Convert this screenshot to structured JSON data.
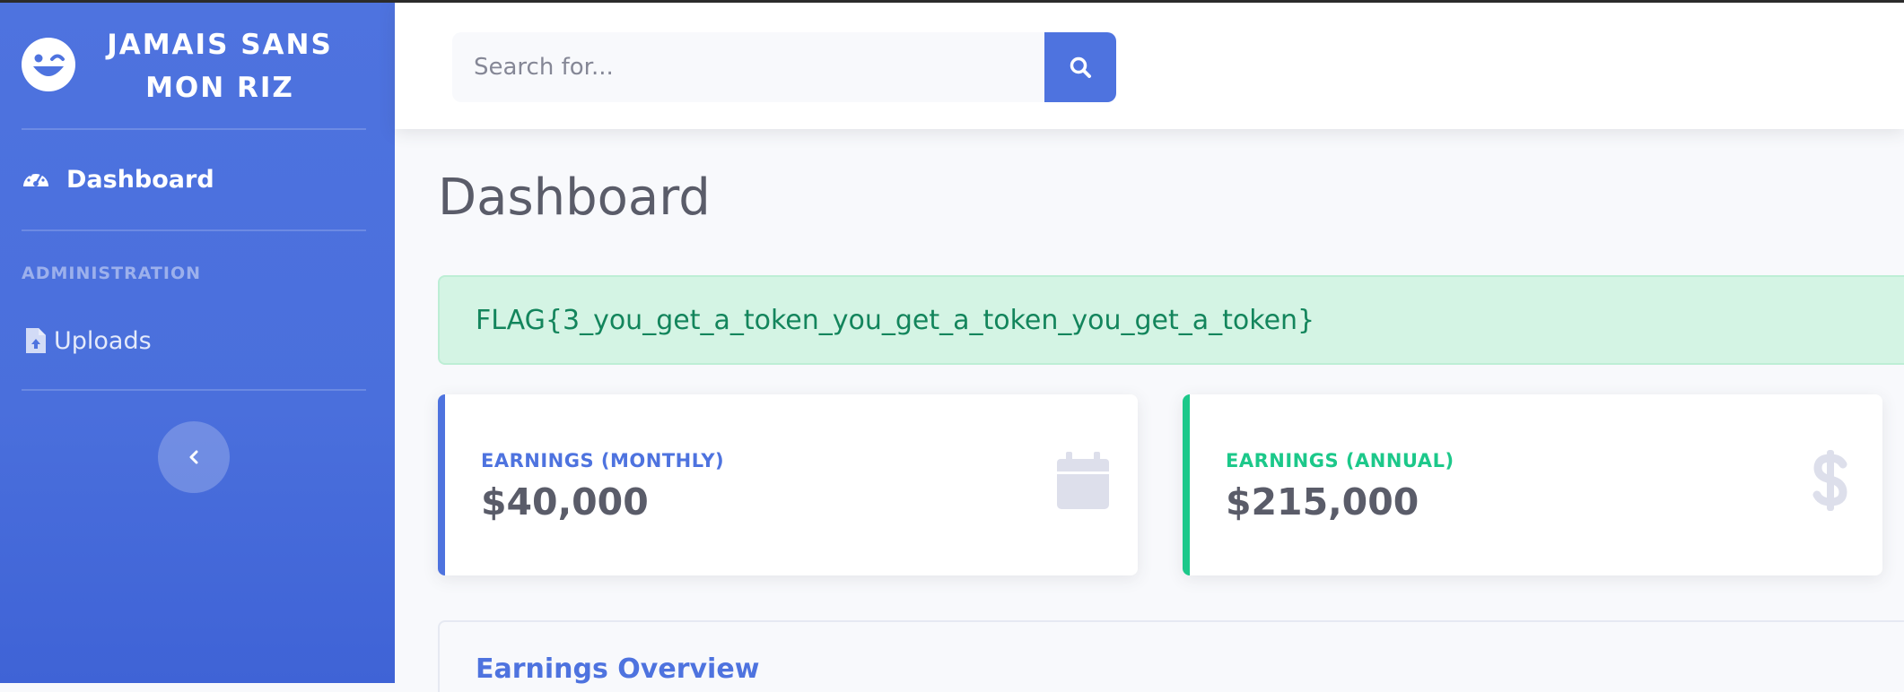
{
  "sidebar": {
    "brand_line1": "JAMAIS SANS",
    "brand_line2": "MON RIZ",
    "brand_icon": "grin-wink-icon",
    "nav": [
      {
        "label": "Dashboard",
        "icon": "tachometer-icon",
        "active": true
      }
    ],
    "section_heading": "ADMINISTRATION",
    "admin_items": [
      {
        "label": "Uploads",
        "icon": "file-upload-icon"
      }
    ],
    "toggle_icon": "chevron-left-icon"
  },
  "topbar": {
    "search_placeholder": "Search for...",
    "search_icon": "search-icon"
  },
  "main": {
    "page_title": "Dashboard",
    "alert_text": "FLAG{3_you_get_a_token_you_get_a_token_you_get_a_token}",
    "cards": [
      {
        "label": "EARNINGS (MONTHLY)",
        "value": "$40,000",
        "icon": "calendar-icon",
        "accent": "#4e73df"
      },
      {
        "label": "EARNINGS (ANNUAL)",
        "value": "$215,000",
        "icon": "dollar-sign-icon",
        "accent": "#1cc88a"
      }
    ],
    "overview_title": "Earnings Overview"
  },
  "colors": {
    "primary": "#4e73df",
    "success": "#1cc88a",
    "alert_bg": "#d4f4e4",
    "alert_text": "#13855c",
    "text_gray": "#5a5c69"
  }
}
